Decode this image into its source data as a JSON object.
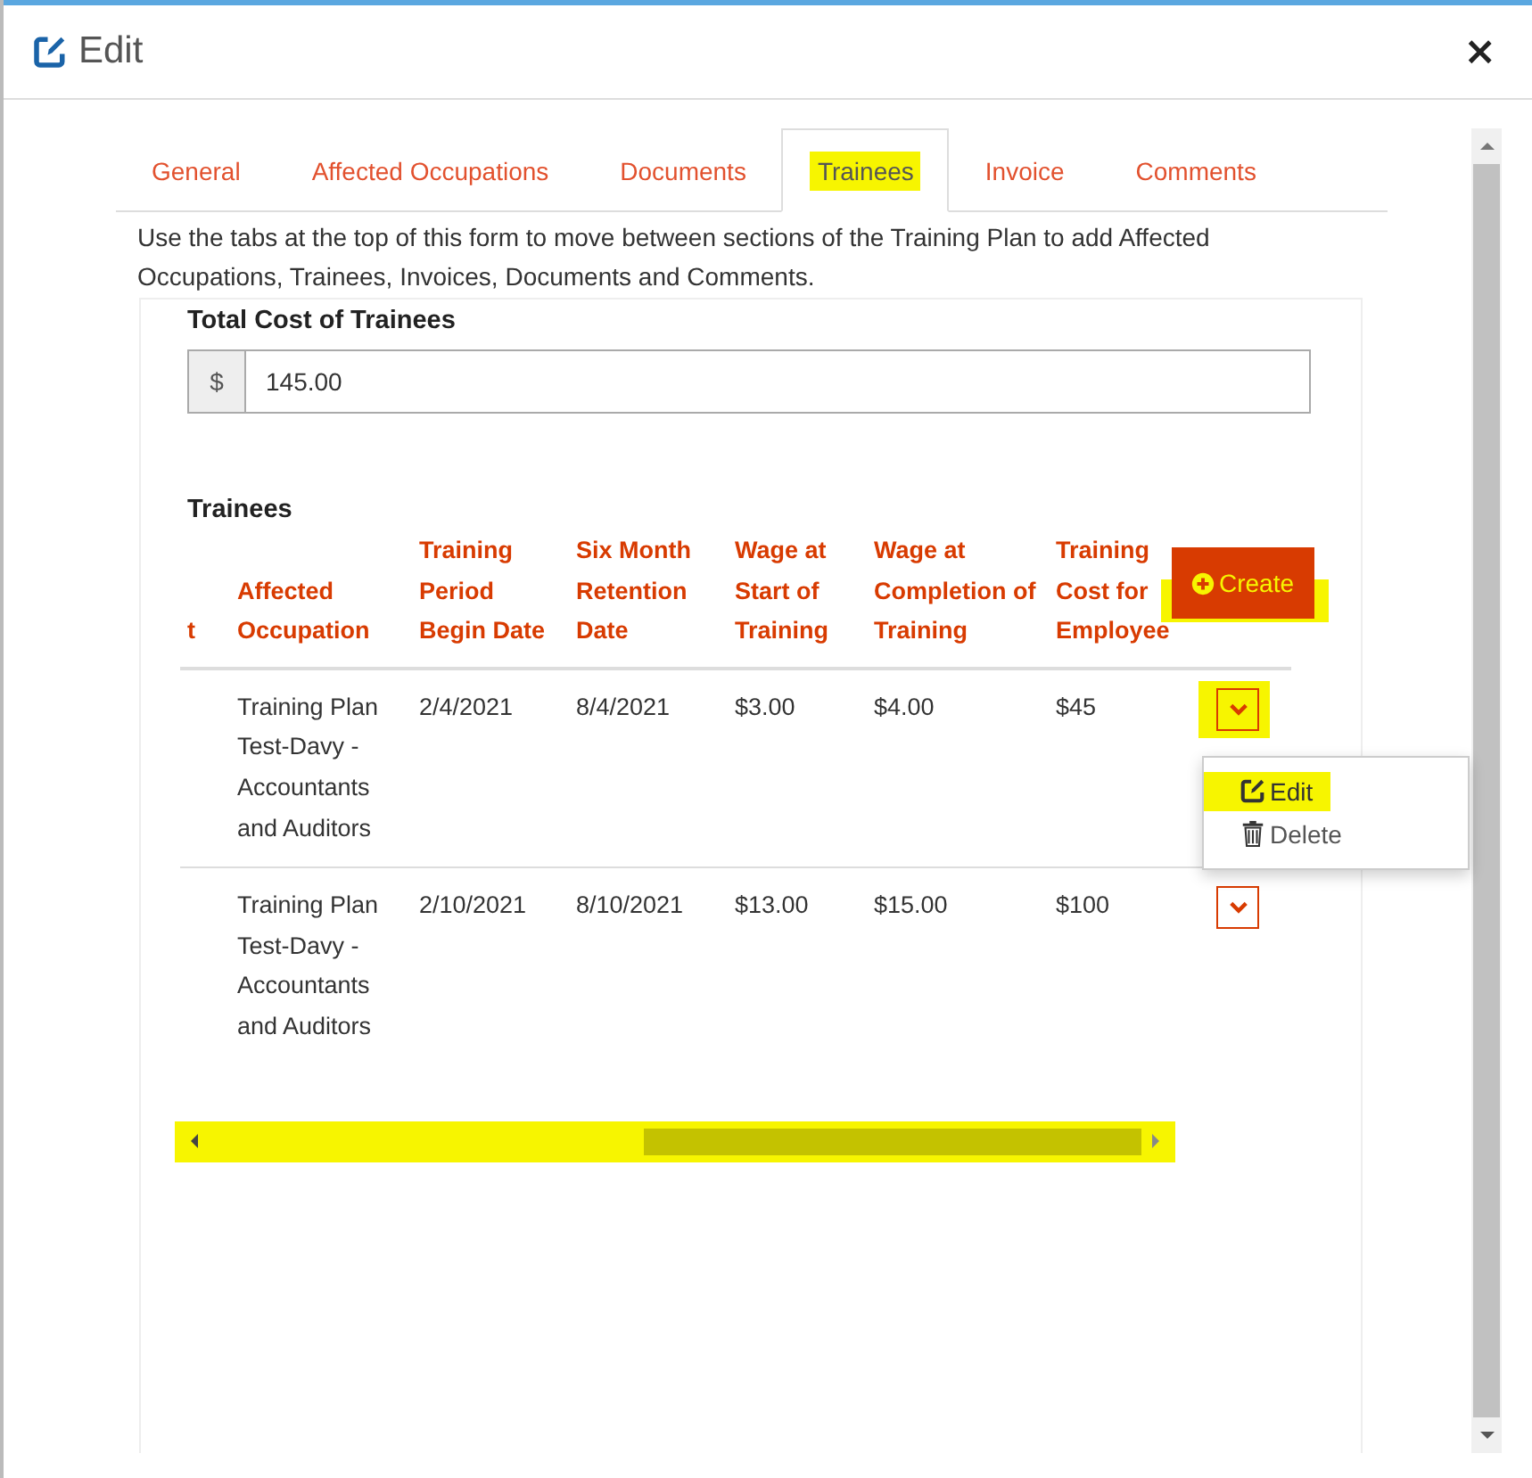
{
  "window": {
    "title": "Edit",
    "close": "×"
  },
  "tabs": [
    {
      "label": "General",
      "selected": false,
      "highlighted": false
    },
    {
      "label": "Affected Occupations",
      "selected": false,
      "highlighted": false
    },
    {
      "label": "Documents",
      "selected": false,
      "highlighted": false
    },
    {
      "label": "Trainees",
      "selected": true,
      "highlighted": true
    },
    {
      "label": "Invoice",
      "selected": false,
      "highlighted": false
    },
    {
      "label": "Comments",
      "selected": false,
      "highlighted": false
    }
  ],
  "description": "Use the tabs at the top of this form to move between sections of the Training Plan to add Affected Occupations, Trainees, Invoices, Documents and Comments.",
  "total_cost": {
    "label": "Total Cost of Trainees",
    "prefix": "$",
    "value": "145.00"
  },
  "trainees": {
    "heading": "Trainees",
    "create_button": {
      "label": "Create",
      "highlighted": true
    },
    "columns": [
      "t",
      "Affected Occupation",
      "Training Period Begin Date",
      "Six Month Retention Date",
      "Wage at Start of Training",
      "Wage at Completion of Training",
      "Training Cost for Employee"
    ],
    "rows": [
      {
        "cells": [
          "",
          "Training Plan Test-Davy - Accountants and Auditors",
          "2/4/2021",
          "8/4/2021",
          "$3.00",
          "$4.00",
          "$45"
        ],
        "expanded": true,
        "highlighted": true,
        "menu": [
          {
            "label": "Edit",
            "kind": "edit",
            "highlighted": true
          },
          {
            "label": "Delete",
            "kind": "delete",
            "highlighted": false
          }
        ]
      },
      {
        "cells": [
          "",
          "Training Plan Test-Davy - Accountants and Auditors",
          "2/10/2021",
          "8/10/2021",
          "$13.00",
          "$15.00",
          "$100"
        ],
        "expanded": false,
        "highlighted": false
      }
    ],
    "scrollbar": {
      "highlighted": true
    }
  }
}
